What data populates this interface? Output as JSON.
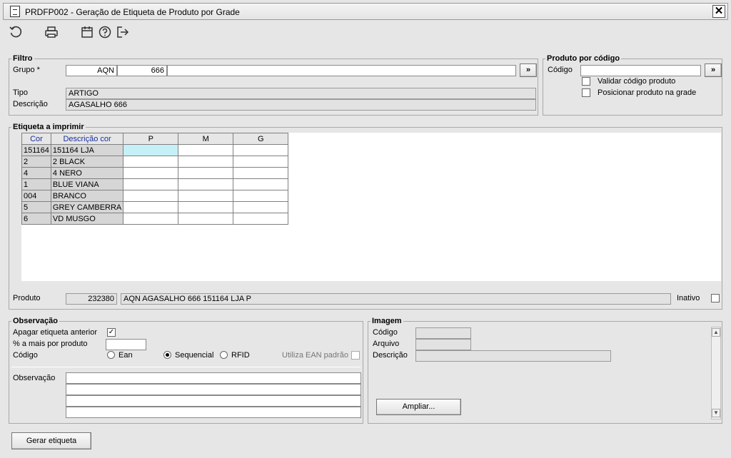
{
  "window": {
    "title": "PRDFP002 - Geração de Etiqueta de Produto por Grade",
    "close": "✕"
  },
  "filtro": {
    "legend": "Filtro",
    "grupo_label": "Grupo *",
    "grupo_code": "AQN",
    "grupo_number": "666",
    "grupo_button": "»",
    "tipo_label": "Tipo",
    "tipo_value": "ARTIGO",
    "descricao_label": "Descrição",
    "descricao_value": "AGASALHO 666"
  },
  "produto_codigo": {
    "legend": "Produto por código",
    "codigo_label": "Código",
    "codigo_value": "",
    "codigo_button": "»",
    "validar_label": "Validar código produto",
    "posicionar_label": "Posicionar produto na grade"
  },
  "etiqueta": {
    "legend": "Etiqueta a imprimir",
    "columns": [
      "Cor",
      "Descrição cor",
      "P",
      "M",
      "G"
    ],
    "rows": [
      {
        "cor": "151164",
        "descricao": "151164 LJA"
      },
      {
        "cor": "2",
        "descricao": "2 BLACK"
      },
      {
        "cor": "4",
        "descricao": "4 NERO"
      },
      {
        "cor": "1",
        "descricao": "BLUE VIANA"
      },
      {
        "cor": "004",
        "descricao": "BRANCO"
      },
      {
        "cor": "5",
        "descricao": "GREY CAMBERRA"
      },
      {
        "cor": "6",
        "descricao": "VD MUSGO"
      }
    ],
    "produto_label": "Produto",
    "produto_code": "232380",
    "produto_desc": "AQN AGASALHO 666 151164 LJA P",
    "inativo_label": "Inativo"
  },
  "observacao": {
    "legend": "Observação",
    "apagar_label": "Apagar etiqueta anterior",
    "apagar_checked": "✓",
    "pct_label": "% a mais por produto",
    "pct_value": "",
    "codigo_label": "Código",
    "radio_ean": "Ean",
    "radio_sequencial": "Sequencial",
    "radio_rfid": "RFID",
    "selected_radio": "Sequencial",
    "utiliza_label": "Utiliza EAN padrão",
    "obs_label": "Observação"
  },
  "imagem": {
    "legend": "Imagem",
    "codigo_label": "Código",
    "arquivo_label": "Arquivo",
    "descricao_label": "Descrição",
    "ampliar_button": "Ampliar..."
  },
  "footer": {
    "gerar_button": "Gerar etiqueta"
  },
  "colors": {
    "selected_cell": "#c6f0f8",
    "header_blue": "#1a2ea0",
    "background": "#e6e6e6"
  }
}
